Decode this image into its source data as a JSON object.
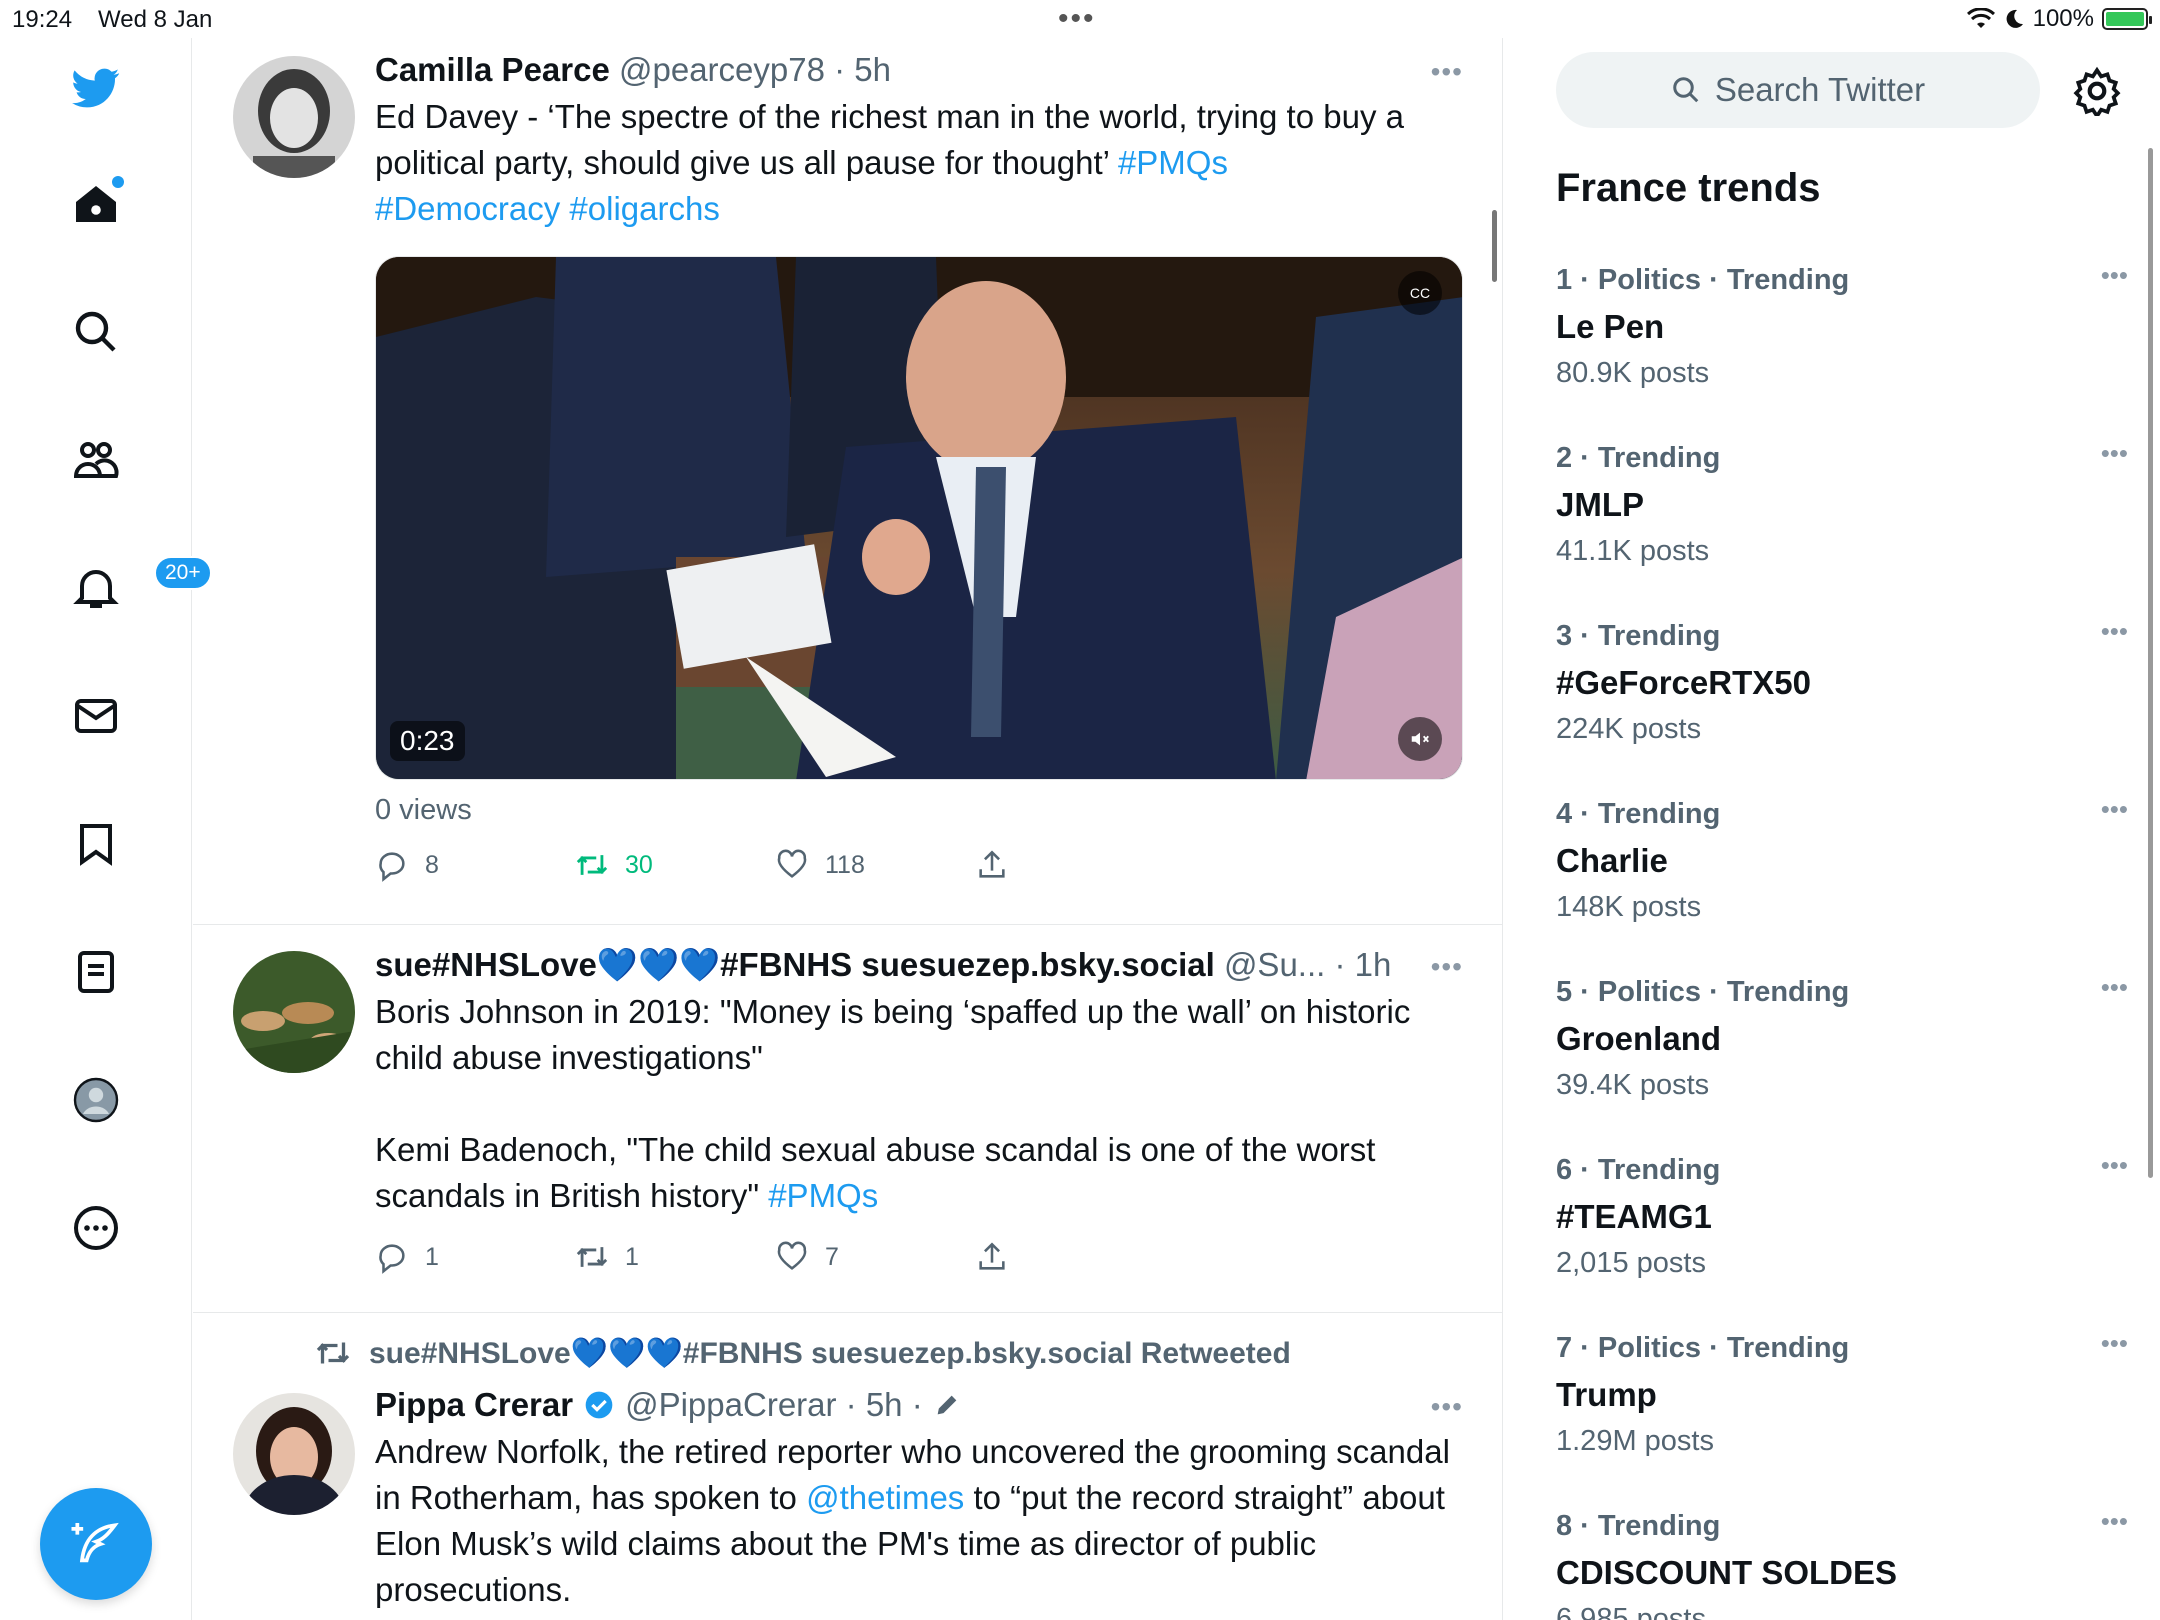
{
  "status_bar": {
    "time": "19:24",
    "date": "Wed 8 Jan",
    "battery": "100%"
  },
  "nav": {
    "notifications_badge": "20+"
  },
  "search": {
    "placeholder": "Search Twitter"
  },
  "trends": {
    "title": "France trends",
    "items": [
      {
        "meta": "1 · Politics · Trending",
        "name": "Le Pen",
        "count": "80.9K posts"
      },
      {
        "meta": "2 · Trending",
        "name": "JMLP",
        "count": "41.1K posts"
      },
      {
        "meta": "3 · Trending",
        "name": "#GeForceRTX50",
        "count": "224K posts"
      },
      {
        "meta": "4 · Trending",
        "name": "Charlie",
        "count": "148K posts"
      },
      {
        "meta": "5 · Politics · Trending",
        "name": "Groenland",
        "count": "39.4K posts"
      },
      {
        "meta": "6 · Trending",
        "name": "#TEAMG1",
        "count": "2,015 posts"
      },
      {
        "meta": "7 · Politics · Trending",
        "name": "Trump",
        "count": "1.29M posts"
      },
      {
        "meta": "8 · Trending",
        "name": "CDISCOUNT SOLDES",
        "count": "6,985 posts"
      }
    ]
  },
  "tweets": [
    {
      "name": "Camilla Pearce",
      "meta": "@pearceyp78 · 5h",
      "text_plain": "Ed Davey  - ‘The spectre of the richest man in the world, trying to buy a political party, should give us all pause for thought’ ",
      "tag1": "#PMQs",
      "tag2": "#Democracy",
      "tag3": "#oligarchs",
      "video_time": "0:23",
      "views": "0 views",
      "replies": "8",
      "retweets": "30",
      "likes": "118"
    },
    {
      "name": "sue#NHSLove💙💙💙#FBNHS suesuezep.bsky.social",
      "meta": "@Su... · 1h",
      "line1": "Boris Johnson in 2019: \"Money is being ‘spaffed up the wall’ on historic child abuse investigations\"",
      "line2": "Kemi Badenoch, \"The child sexual abuse scandal is one of the worst scandals in British history\" ",
      "tag": "#PMQs",
      "replies": "1",
      "retweets": "1",
      "likes": "7"
    },
    {
      "retweeted_by": "sue#NHSLove💙💙💙#FBNHS suesuezep.bsky.social Retweeted",
      "name": "Pippa Crerar",
      "meta": "@PippaCrerar · 5h ·",
      "text_a": "Andrew Norfolk, the retired reporter who uncovered the grooming scandal in Rotherham, has spoken to ",
      "mention": "@thetimes",
      "text_b": " to “put the record straight” about Elon Musk’s wild claims about the PM's time as director of public prosecutions."
    }
  ]
}
